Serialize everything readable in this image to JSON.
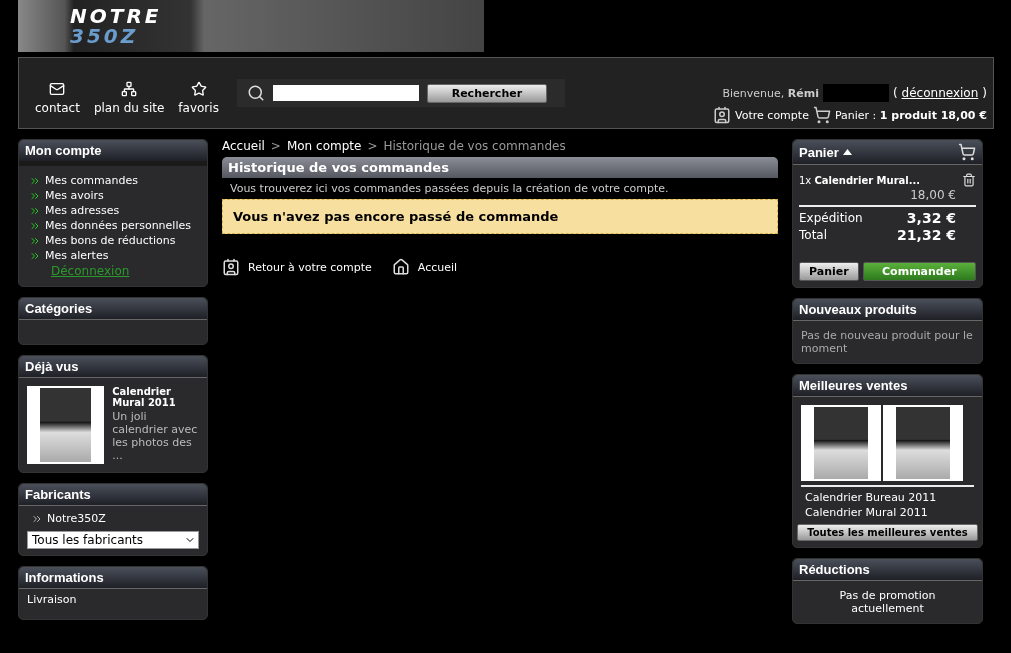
{
  "banner": {
    "logo_top": "NOTRE",
    "logo_bottom": "350Z"
  },
  "nav": {
    "links": [
      {
        "label": "contact",
        "kind": "mail"
      },
      {
        "label": "plan du site",
        "kind": "sitemap"
      },
      {
        "label": "favoris",
        "kind": "star"
      }
    ],
    "search": {
      "button": "Rechercher"
    },
    "welcome": "Bienvenue, **Rémi**",
    "logout_before": "(",
    "logout": "déconnexion",
    "logout_after": ")",
    "account": "Votre compte",
    "cart": "Panier : **1 produit 18,00 €**"
  },
  "left": {
    "account_box": {
      "title": "Mon compte",
      "items": [
        "Mes commandes",
        "Mes avoirs",
        "Mes adresses",
        "Mes données personnelles",
        "Mes bons de réductions",
        "Mes alertes"
      ],
      "logout": "Déconnexion"
    },
    "categories": {
      "title": "Catégories"
    },
    "viewed": {
      "title": "Déjà vus",
      "product": "Calendrier Mural 2011",
      "description": "Un joli calendrier avec les photos des ..."
    },
    "manufacturers": {
      "title": "Fabricants",
      "items": [
        "Notre350Z"
      ],
      "select": "Tous les fabricants"
    },
    "info": {
      "title": "Informations",
      "items": [
        "Livraison"
      ]
    }
  },
  "breadcrumb": [
    "Accueil",
    "Mon compte",
    "Historique de vos commandes"
  ],
  "breadcrumb_separator": ">",
  "content": {
    "title": "Historique de vos commandes",
    "intro": "Vous trouverez ici vos commandes passées depuis la création de votre compte.",
    "warning": "Vous n'avez pas encore passé de commande",
    "links": [
      {
        "label": "Retour à votre compte",
        "kind": "account"
      },
      {
        "label": "Accueil",
        "kind": "home"
      }
    ]
  },
  "right": {
    "cart": {
      "title": "Panier",
      "item": "1x **Calendrier Mural...**",
      "price": "18,00 €",
      "rows": [
        {
          "label": "Expédition",
          "value": "3,32 €"
        },
        {
          "label": "Total",
          "value": "21,32 €"
        }
      ],
      "buttons": [
        {
          "label": "Panier",
          "kind": "secondary"
        },
        {
          "label": "Commander",
          "kind": "primary"
        }
      ]
    },
    "new_products": {
      "title": "Nouveaux produits",
      "text": "Pas de nouveau produit pour le moment"
    },
    "best_sellers": {
      "title": "Meilleures ventes",
      "items": [
        "Calendrier Bureau 2011",
        "Calendrier Mural 2011"
      ],
      "button": "Toutes les meilleures ventes"
    },
    "discounts": {
      "title": "Réductions",
      "text": "Pas de promotion actuellement"
    }
  }
}
